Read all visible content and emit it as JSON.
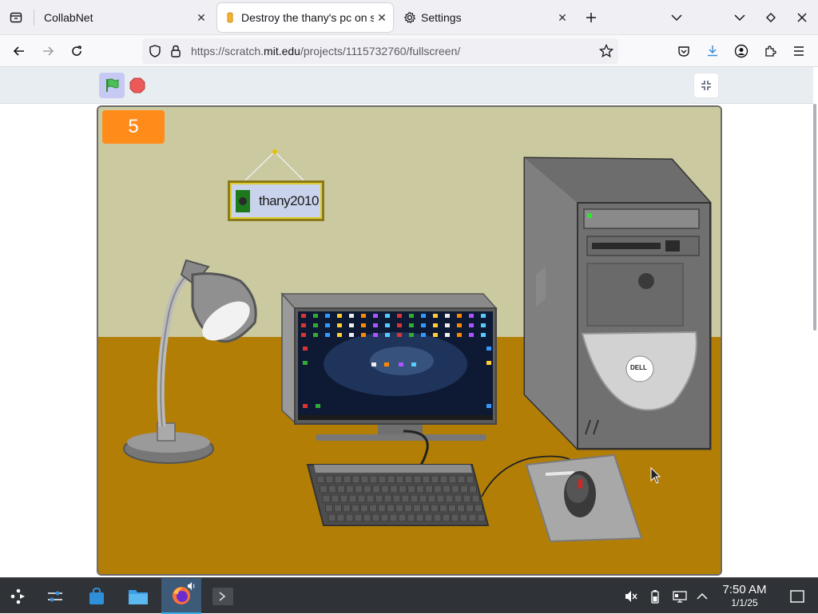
{
  "browser": {
    "tabs": [
      {
        "title": "CollabNet",
        "active": false
      },
      {
        "title": "Destroy the thany's pc on s",
        "active": true
      },
      {
        "title": "Settings",
        "active": false
      }
    ],
    "url_prefix": "https://scratch.",
    "url_domain": "mit.edu",
    "url_path": "/projects/1115732760/fullscreen/"
  },
  "scratch": {
    "score": "5",
    "plaque_name": "thany2010",
    "monitor_brand": "DELL"
  },
  "colors": {
    "accent_orange": "#ff8c1a",
    "flag_green": "#4cbf56",
    "stop_red": "#ec5959",
    "wall": "#cbc9a0",
    "floor": "#b37e06"
  },
  "taskbar": {
    "time": "7:50 AM",
    "date": "1/1/25"
  }
}
